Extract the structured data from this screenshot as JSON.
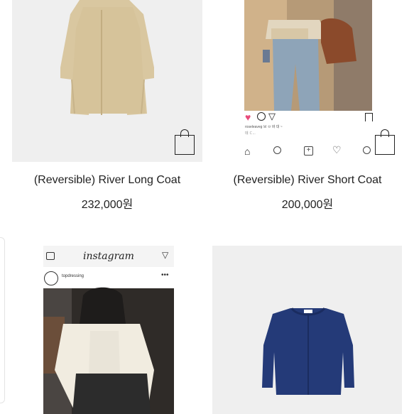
{
  "products": [
    {
      "name": "(Reversible) River Long Coat",
      "price": "232,000원"
    },
    {
      "name": "(Reversible) River Short Coat",
      "price": "200,000원"
    },
    {
      "name": "",
      "price": ""
    },
    {
      "name": "",
      "price": ""
    }
  ],
  "instagram_post_top": {
    "caption": "roseleaveg 브 ㅂ 바 대 ~",
    "more": "데 ㄷ..."
  },
  "instagram_post_bottom": {
    "wordmark": "instagram",
    "username": "topdressing"
  }
}
